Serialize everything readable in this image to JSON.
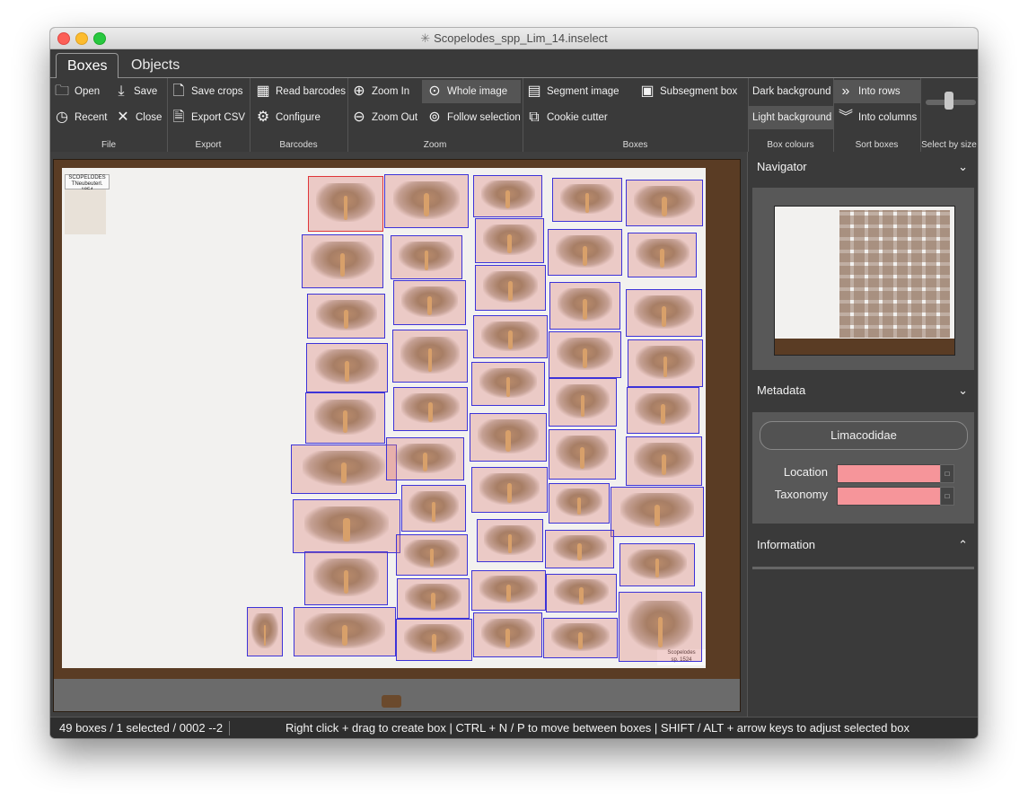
{
  "window": {
    "title": "Scopelodes_spp_Lim_14.inselect"
  },
  "tabs": [
    {
      "label": "Boxes",
      "active": true
    },
    {
      "label": "Objects",
      "active": false
    }
  ],
  "ribbon": {
    "file": {
      "label": "File",
      "open": "Open",
      "save": "Save",
      "recent": "Recent",
      "close": "Close"
    },
    "export": {
      "label": "Export",
      "save_crops": "Save crops",
      "export_csv": "Export CSV"
    },
    "barcodes": {
      "label": "Barcodes",
      "read_barcodes": "Read barcodes",
      "configure": "Configure"
    },
    "zoom": {
      "label": "Zoom",
      "zoom_in": "Zoom In",
      "zoom_out": "Zoom Out",
      "whole_image": "Whole image",
      "follow_selection": "Follow selection"
    },
    "boxes": {
      "label": "Boxes",
      "segment_image": "Segment image",
      "subsegment_box": "Subsegment box",
      "cookie_cutter": "Cookie cutter"
    },
    "box_colours": {
      "label": "Box colours",
      "dark_background": "Dark background",
      "light_background": "Light background"
    },
    "sort_boxes": {
      "label": "Sort boxes",
      "into_rows": "Into rows",
      "into_columns": "Into columns"
    },
    "select_by_size": {
      "label": "Select by size"
    }
  },
  "drawer": {
    "label_top": "SCOPELODES\nTNeubeuterl. 1854",
    "label_corner": "Scopelodes\nsp. 1524"
  },
  "panel": {
    "navigator": {
      "title": "Navigator"
    },
    "metadata": {
      "title": "Metadata",
      "family": "Limacodidae",
      "location_label": "Location",
      "taxonomy_label": "Taxonomy"
    },
    "information": {
      "title": "Information"
    }
  },
  "status": {
    "left": "49 boxes / 1 selected / 0002 --2",
    "right": "Right click + drag to create box  |  CTRL + N / P to move between boxes  |  SHIFT / ALT + arrow keys to adjust selected box"
  },
  "colors": {
    "box_outline": "#3d33d8",
    "selected_outline": "#e0363a",
    "field_fill": "#f6959a"
  }
}
